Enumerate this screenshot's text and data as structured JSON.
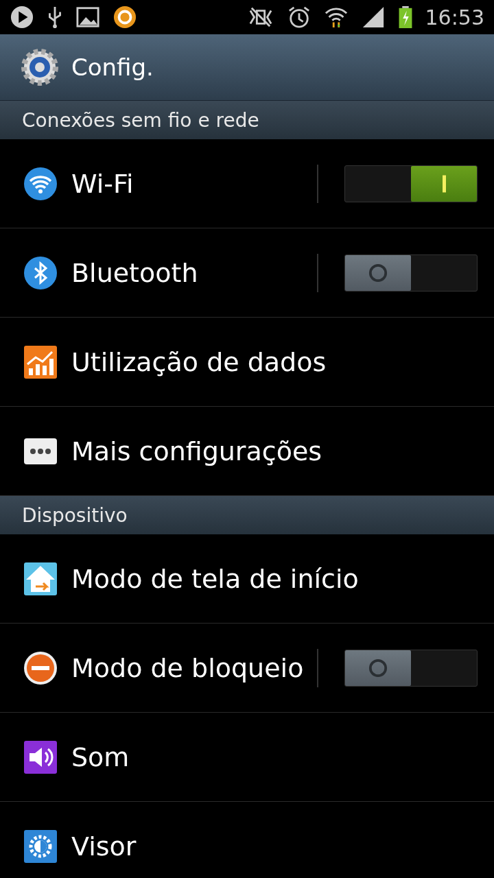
{
  "status_bar": {
    "time": "16:53"
  },
  "action_bar": {
    "title": "Config."
  },
  "sections": [
    {
      "header": "Conexões sem fio e rede",
      "items": [
        {
          "label": "Wi-Fi",
          "kind": "toggle",
          "on": true
        },
        {
          "label": "Bluetooth",
          "kind": "toggle",
          "on": false
        },
        {
          "label": "Utilização de dados",
          "kind": "plain"
        },
        {
          "label": "Mais configurações",
          "kind": "plain"
        }
      ]
    },
    {
      "header": "Dispositivo",
      "items": [
        {
          "label": "Modo de tela de início",
          "kind": "plain"
        },
        {
          "label": "Modo de bloqueio",
          "kind": "toggle",
          "on": false
        },
        {
          "label": "Som",
          "kind": "plain"
        },
        {
          "label": "Visor",
          "kind": "plain"
        }
      ]
    }
  ]
}
